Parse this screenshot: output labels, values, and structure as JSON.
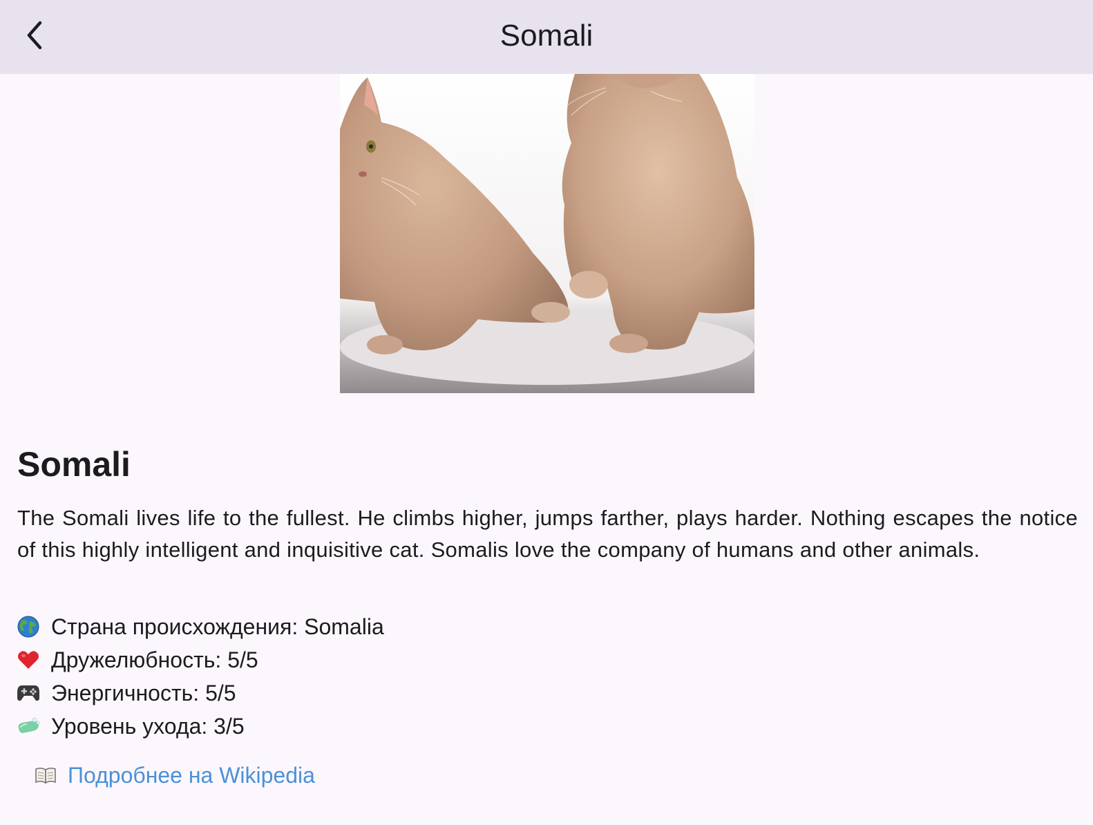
{
  "nav": {
    "title": "Somali",
    "back_icon": "chevron-left-icon"
  },
  "photo": {
    "alt": "Somali"
  },
  "breed": {
    "name": "Somali",
    "description": "The Somali lives life to the fullest. He climbs higher, jumps farther, plays harder. Nothing escapes the notice of this highly intelligent and inquisitive cat. Somalis love the company of humans and other animals."
  },
  "stats": [
    {
      "icon": "globe-icon",
      "text": "Страна происхождения: Somalia"
    },
    {
      "icon": "heart-icon",
      "text": "Дружелюбность: 5/5"
    },
    {
      "icon": "gamepad-icon",
      "text": "Энергичность: 5/5"
    },
    {
      "icon": "soap-icon",
      "text": "Уровень ухода: 3/5"
    }
  ],
  "wiki": {
    "icon": "book-icon",
    "label": "Подробнее на Wikipedia"
  },
  "colors": {
    "nav_background": "#e8e2ef",
    "page_background": "#fcf7fc",
    "link": "#4a90d9"
  }
}
